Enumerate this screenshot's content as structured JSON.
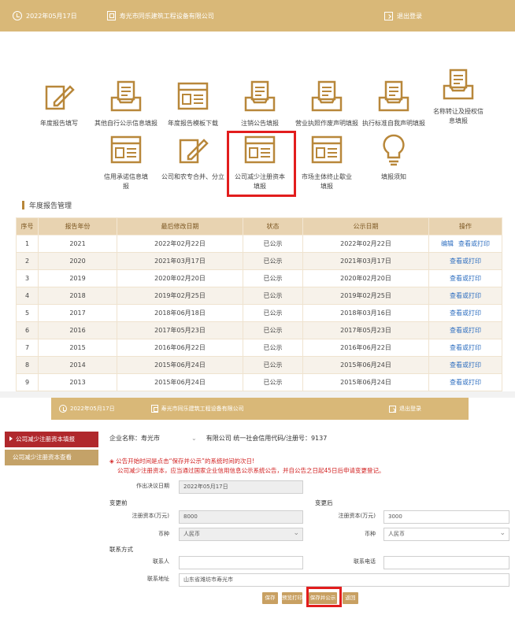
{
  "top": {
    "date": "2022年05月17日",
    "company": "寿光市同乐建筑工程设备有限公司",
    "logout": "退出登录"
  },
  "tiles": [
    {
      "label": "年度报告填写",
      "icon": "edit-doc-icon"
    },
    {
      "label": "其他自行公示信息填报",
      "icon": "tray-doc-icon"
    },
    {
      "label": "年度报告模板下载",
      "icon": "form-doc-icon"
    },
    {
      "label": "注销公告填报",
      "icon": "tray-doc-icon"
    },
    {
      "label": "营业执照作废声明填报",
      "icon": "tray-doc-icon"
    },
    {
      "label": "执行标准自我声明填报",
      "icon": "tray-doc-icon"
    },
    {
      "label": "名称转让及授权信息填报",
      "icon": "tray-doc-icon"
    },
    {
      "label": "信用承诺信息填报",
      "icon": "form-doc-icon"
    },
    {
      "label": "公司和农专合并、分立",
      "icon": "edit-doc-icon"
    },
    {
      "label": "公司减少注册资本填报",
      "icon": "form-doc-icon"
    },
    {
      "label": "市场主体终止歇业填报",
      "icon": "form-doc-icon"
    },
    {
      "label": "填报须知",
      "icon": "lightbulb-icon"
    }
  ],
  "report": {
    "title": "年度报告管理",
    "headers": [
      "序号",
      "报告年份",
      "最后修改日期",
      "状态",
      "公示日期",
      "操作"
    ],
    "rows": [
      {
        "no": "1",
        "year": "2021",
        "modified": "2022年02月22日",
        "status": "已公示",
        "pub": "2022年02月22日",
        "edit": "编辑",
        "view": "查看或打印"
      },
      {
        "no": "2",
        "year": "2020",
        "modified": "2021年03月17日",
        "status": "已公示",
        "pub": "2021年03月17日",
        "edit": "",
        "view": "查看或打印"
      },
      {
        "no": "3",
        "year": "2019",
        "modified": "2020年02月20日",
        "status": "已公示",
        "pub": "2020年02月20日",
        "edit": "",
        "view": "查看或打印"
      },
      {
        "no": "4",
        "year": "2018",
        "modified": "2019年02月25日",
        "status": "已公示",
        "pub": "2019年02月25日",
        "edit": "",
        "view": "查看或打印"
      },
      {
        "no": "5",
        "year": "2017",
        "modified": "2018年06月18日",
        "status": "已公示",
        "pub": "2018年03月16日",
        "edit": "",
        "view": "查看或打印"
      },
      {
        "no": "6",
        "year": "2016",
        "modified": "2017年05月23日",
        "status": "已公示",
        "pub": "2017年05月23日",
        "edit": "",
        "view": "查看或打印"
      },
      {
        "no": "7",
        "year": "2015",
        "modified": "2016年06月22日",
        "status": "已公示",
        "pub": "2016年06月22日",
        "edit": "",
        "view": "查看或打印"
      },
      {
        "no": "8",
        "year": "2014",
        "modified": "2015年06月24日",
        "status": "已公示",
        "pub": "2015年06月24日",
        "edit": "",
        "view": "查看或打印"
      },
      {
        "no": "9",
        "year": "2013",
        "modified": "2015年06月24日",
        "status": "已公示",
        "pub": "2015年06月24日",
        "edit": "",
        "view": "查看或打印"
      }
    ]
  },
  "top2": {
    "date": "2022年05月17日",
    "company": "寿光市同乐建筑工程设备有限公司",
    "logout": "退出登录"
  },
  "sidebar": [
    "公司减少注册资本填报",
    "公司减少注册资本查看"
  ],
  "form": {
    "company_prefix": "企业名称：寿光市",
    "company_suffix": "有限公司",
    "code_label": "统一社会信用代码/注册号：",
    "code_value": "9137",
    "notice1": "公告开始时间是点击“保存并公示”的系统时间的次日!",
    "notice2": "公司减少注册资本，应当通过国家企业信用信息公示系统公告，并自公告之日起45日后申请变更登记。",
    "resolution_date_label": "作出决议日期",
    "resolution_date": "2022年05月17日",
    "before_label": "变更前",
    "after_label": "变更后",
    "capital_label": "注册资本(万元)",
    "capital_before": "8000",
    "capital_after": "3000",
    "currency_label": "币种",
    "currency_before": "人民币",
    "currency_after": "人民币",
    "contact_section": "联系方式",
    "contact_label": "联系人",
    "contact_value": "",
    "phone_label": "联系电话",
    "phone_value": "",
    "address_label": "联系地址",
    "address_value": "山东省潍坊市寿光市",
    "buttons": [
      "保存",
      "预览打印",
      "保存并公示",
      "返回"
    ]
  }
}
